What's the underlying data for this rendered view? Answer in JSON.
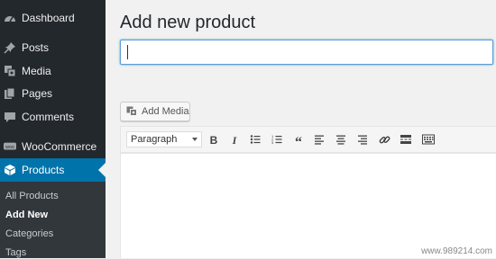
{
  "sidebar": {
    "items": [
      {
        "label": "Dashboard",
        "icon": "dashboard-icon"
      },
      {
        "label": "Posts",
        "icon": "pin-icon"
      },
      {
        "label": "Media",
        "icon": "media-icon"
      },
      {
        "label": "Pages",
        "icon": "pages-icon"
      },
      {
        "label": "Comments",
        "icon": "comment-icon"
      },
      {
        "label": "WooCommerce",
        "icon": "woocommerce-icon"
      },
      {
        "label": "Products",
        "icon": "products-box-icon",
        "active": true
      }
    ],
    "submenu": [
      {
        "label": "All Products"
      },
      {
        "label": "Add New",
        "current": true
      },
      {
        "label": "Categories"
      },
      {
        "label": "Tags"
      }
    ]
  },
  "main": {
    "title": "Add new product",
    "title_input_value": "",
    "add_media_label": "Add Media",
    "format_select_value": "Paragraph"
  },
  "toolbar": {
    "buttons": [
      "bold-icon",
      "italic-icon",
      "bullet-list-icon",
      "numbered-list-icon",
      "blockquote-icon",
      "align-left-icon",
      "align-center-icon",
      "align-right-icon",
      "link-icon",
      "read-more-icon",
      "toolbar-toggle-icon"
    ]
  },
  "watermark": "www.989214.com",
  "colors": {
    "sidebar_bg": "#23282d",
    "submenu_bg": "#32373c",
    "active_blue": "#0073aa",
    "page_bg": "#f1f1f1"
  }
}
